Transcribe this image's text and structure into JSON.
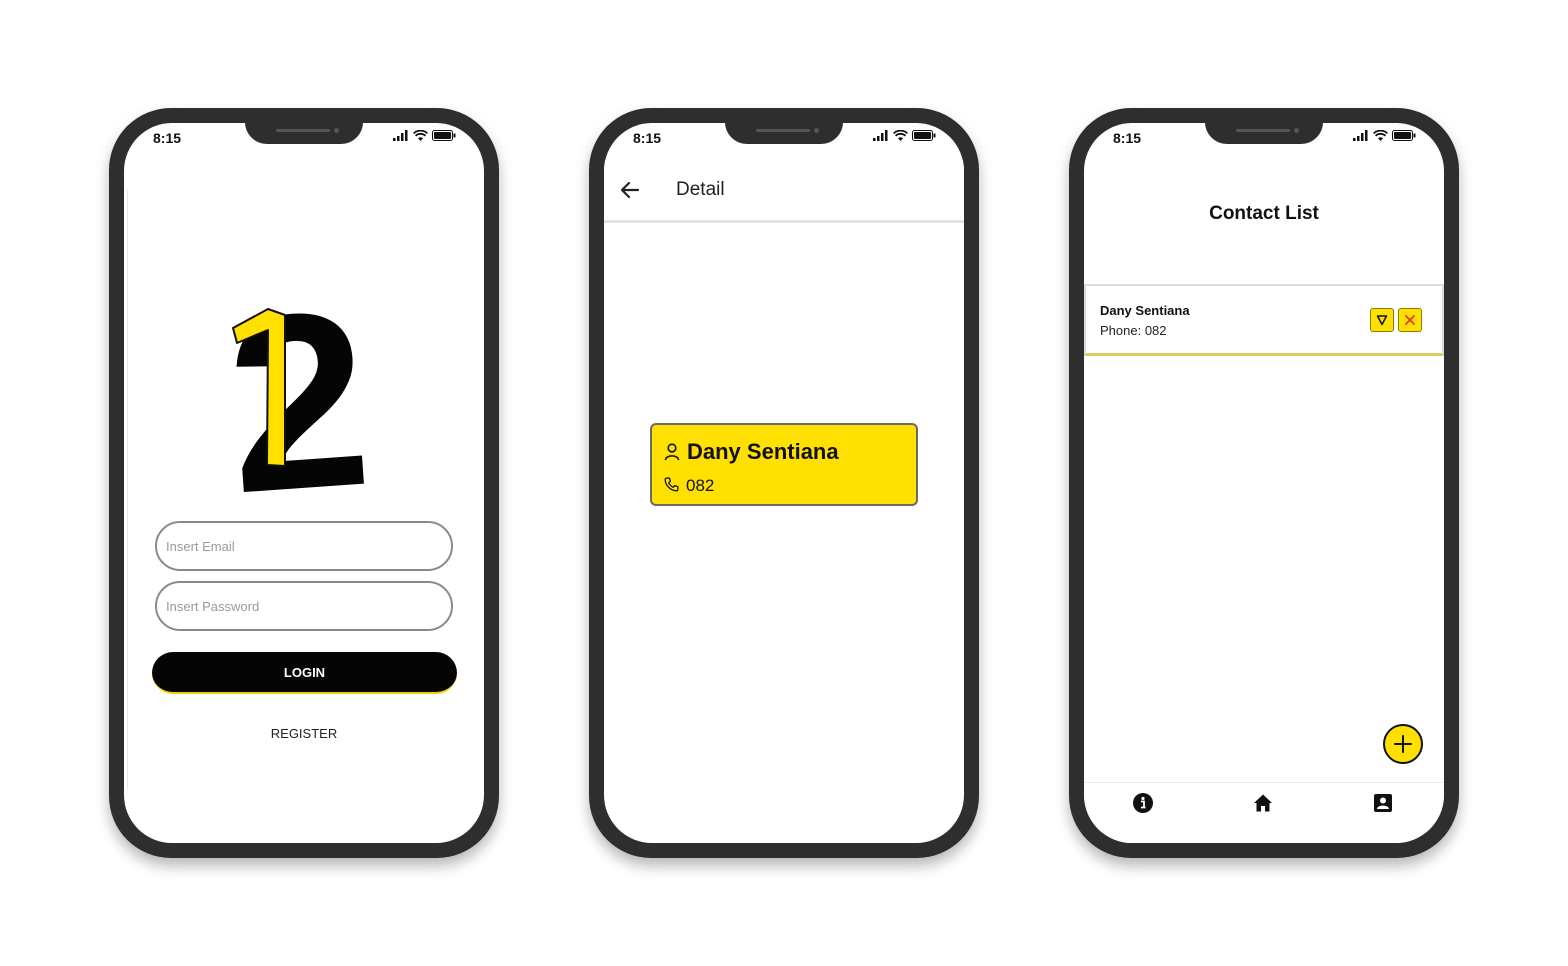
{
  "status_bar": {
    "time": "8:15"
  },
  "login": {
    "logo": {
      "digit_front": "1",
      "digit_back": "2"
    },
    "email_placeholder": "Insert Email",
    "password_placeholder": "Insert Password",
    "login_label": "LOGIN",
    "register_label": "REGISTER"
  },
  "detail": {
    "title": "Detail",
    "name": "Dany Sentiana",
    "phone": "082"
  },
  "contact_list": {
    "title": "Contact List",
    "contacts": [
      {
        "name": "Dany Sentiana",
        "phone": "Phone: 082"
      }
    ],
    "bottom_nav": [
      "info-icon",
      "home-icon",
      "contact-icon"
    ]
  },
  "colors": {
    "accent": "#ffe000",
    "dark": "#050505",
    "phone_frame": "#2e2e2e",
    "delete_x": "#e23a1d"
  }
}
